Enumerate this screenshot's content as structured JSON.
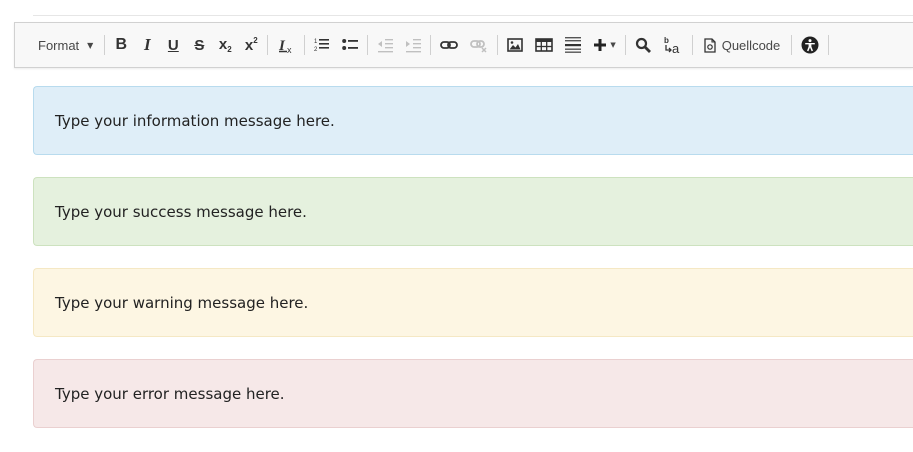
{
  "toolbar": {
    "format_label": "Format",
    "source_label": "Quellcode",
    "buttons": [
      "bold-icon",
      "italic-icon",
      "underline-icon",
      "strikethrough-icon",
      "subscript-icon",
      "superscript-icon",
      "remove-format-icon",
      "numbered-list-icon",
      "bulleted-list-icon",
      "decrease-indent-icon",
      "increase-indent-icon",
      "link-icon",
      "unlink-icon",
      "image-icon",
      "table-icon",
      "horizontal-line-icon",
      "insert-plus-icon",
      "search-icon",
      "replace-icon",
      "source-icon",
      "accessibility-icon"
    ]
  },
  "messages": {
    "info": "Type your information message here.",
    "success": "Type your success message here.",
    "warning": "Type your warning message here.",
    "error": "Type your error message here."
  },
  "colors": {
    "info_bg": "#dfeef8",
    "success_bg": "#e5f1de",
    "warning_bg": "#fdf6e3",
    "error_bg": "#f6e8e8"
  }
}
